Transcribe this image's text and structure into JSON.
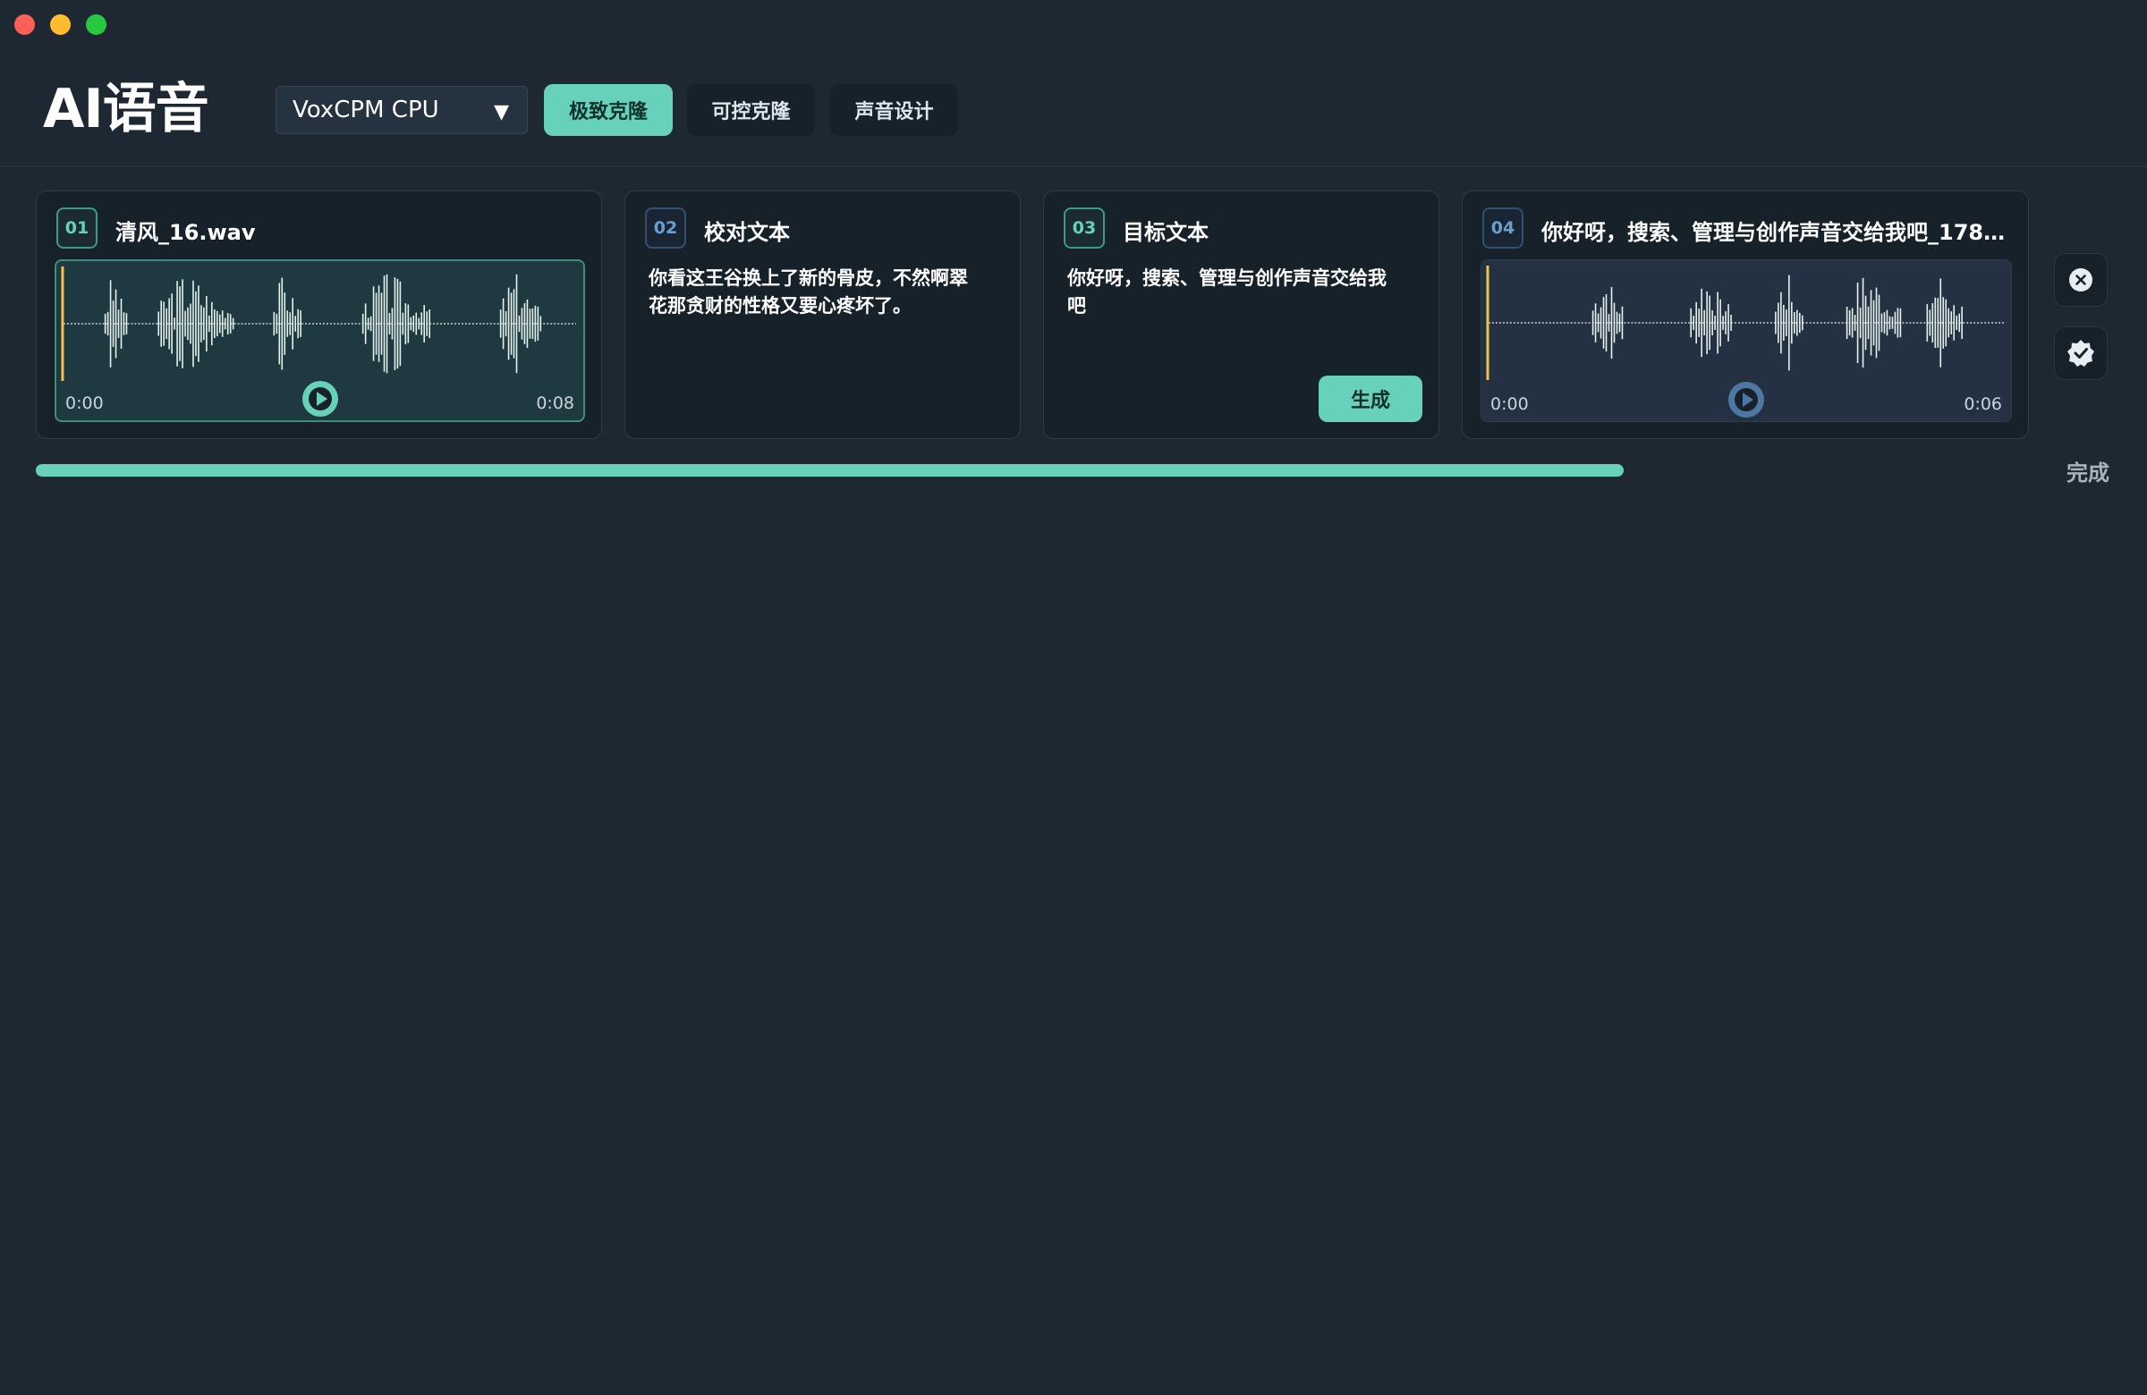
{
  "window": {
    "controls": [
      "close",
      "minimize",
      "zoom"
    ]
  },
  "header": {
    "title": "AI语音",
    "model_select": {
      "value": "VoxCPM CPU",
      "caret_icon": "▼"
    },
    "tabs": [
      {
        "label": "极致克隆",
        "active": true
      },
      {
        "label": "可控克隆",
        "active": false
      },
      {
        "label": "声音设计",
        "active": false
      }
    ]
  },
  "cards": [
    {
      "number": "01",
      "title": "清风_16.wav",
      "audio": {
        "start": "0:00",
        "end": "0:08"
      }
    },
    {
      "number": "02",
      "title": "校对文本",
      "text": "你看这王谷换上了新的骨皮，不然啊翠花那贪财的性格又要心疼坏了。"
    },
    {
      "number": "03",
      "title": "目标文本",
      "text": "你好呀，搜索、管理与创作声音交给我吧",
      "button": "生成"
    },
    {
      "number": "04",
      "title": "你好呀，搜索、管理与创作声音交给我吧_178...",
      "audio": {
        "start": "0:00",
        "end": "0:06"
      }
    }
  ],
  "side_buttons": {
    "close_icon": "close-icon",
    "verify_icon": "verified-badge-icon"
  },
  "progress": {
    "fraction": 0.87,
    "label": "完成"
  },
  "colors": {
    "accent": "#67d1bb",
    "background": "#1d2832",
    "card": "#17212a",
    "playhead": "#f2c14e"
  }
}
